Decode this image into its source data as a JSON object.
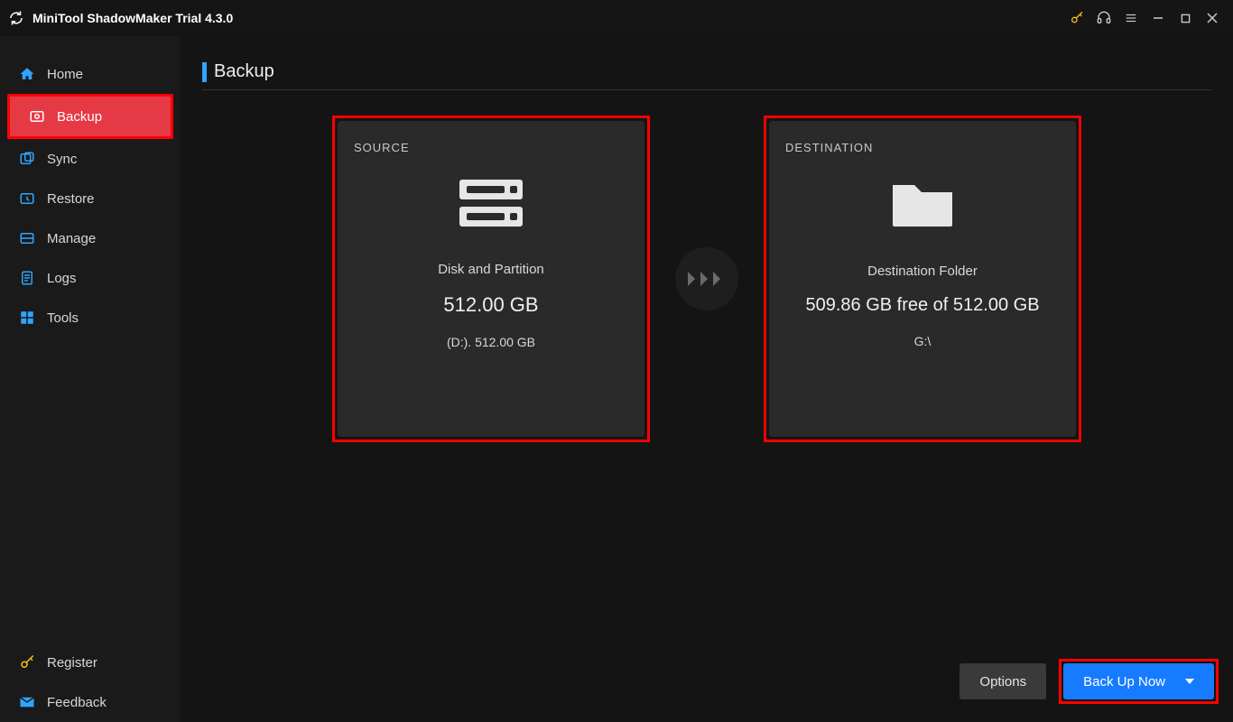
{
  "app": {
    "title": "MiniTool ShadowMaker Trial 4.3.0"
  },
  "sidebar": {
    "items": [
      {
        "label": "Home"
      },
      {
        "label": "Backup"
      },
      {
        "label": "Sync"
      },
      {
        "label": "Restore"
      },
      {
        "label": "Manage"
      },
      {
        "label": "Logs"
      },
      {
        "label": "Tools"
      }
    ],
    "register_label": "Register",
    "feedback_label": "Feedback"
  },
  "page": {
    "title": "Backup"
  },
  "source": {
    "heading": "SOURCE",
    "title": "Disk and Partition",
    "total": "512.00 GB",
    "detail": "(D:). 512.00 GB"
  },
  "destination": {
    "heading": "DESTINATION",
    "title": "Destination Folder",
    "space": "509.86 GB free of 512.00 GB",
    "path": "G:\\"
  },
  "footer": {
    "options_label": "Options",
    "backup_label": "Back Up Now"
  }
}
